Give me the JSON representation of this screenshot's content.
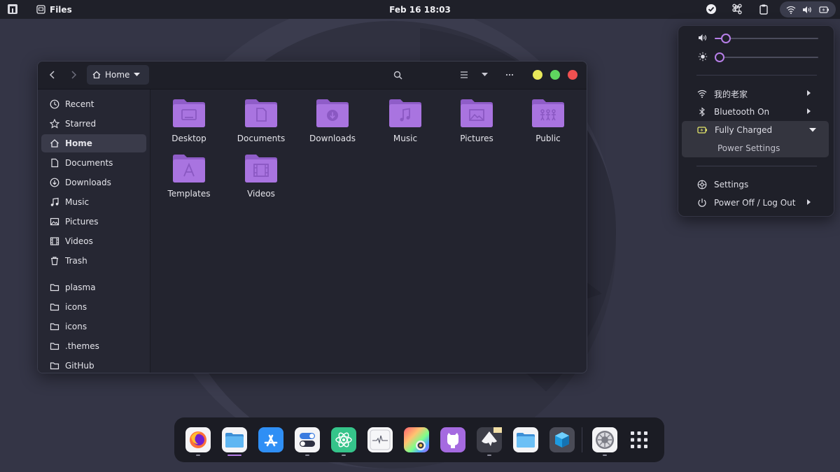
{
  "topbar": {
    "app_name": "Files",
    "clock": "Feb 16  18:03",
    "tray": [
      "checkmark-icon",
      "command-icon",
      "clipboard-icon"
    ],
    "status": [
      "wifi-icon",
      "volume-icon",
      "battery-icon"
    ]
  },
  "window": {
    "path": "Home",
    "sidebar": [
      {
        "label": "Recent",
        "icon": "clock-icon"
      },
      {
        "label": "Starred",
        "icon": "star-icon"
      },
      {
        "label": "Home",
        "icon": "home-icon",
        "active": true
      },
      {
        "label": "Documents",
        "icon": "document-icon"
      },
      {
        "label": "Downloads",
        "icon": "download-icon"
      },
      {
        "label": "Music",
        "icon": "music-icon"
      },
      {
        "label": "Pictures",
        "icon": "picture-icon"
      },
      {
        "label": "Videos",
        "icon": "video-icon"
      },
      {
        "label": "Trash",
        "icon": "trash-icon"
      }
    ],
    "bookmarks": [
      {
        "label": "plasma"
      },
      {
        "label": "icons"
      },
      {
        "label": "icons"
      },
      {
        "label": ".themes"
      },
      {
        "label": "GitHub"
      }
    ],
    "folders": [
      {
        "label": "Desktop",
        "emblem": "desktop"
      },
      {
        "label": "Documents",
        "emblem": "document"
      },
      {
        "label": "Downloads",
        "emblem": "download"
      },
      {
        "label": "Music",
        "emblem": "music"
      },
      {
        "label": "Pictures",
        "emblem": "picture"
      },
      {
        "label": "Public",
        "emblem": "people"
      },
      {
        "label": "Templates",
        "emblem": "template"
      },
      {
        "label": "Videos",
        "emblem": "video"
      }
    ]
  },
  "quick_settings": {
    "volume_level": 0.1,
    "brightness_level": 0.04,
    "items": {
      "wifi": "我的老家",
      "bluetooth": "Bluetooth On",
      "battery": "Fully Charged",
      "power_settings": "Power Settings",
      "settings": "Settings",
      "power_off": "Power Off / Log Out"
    }
  },
  "dock": {
    "apps": [
      "firefox",
      "files",
      "app-store",
      "tweaks",
      "atom",
      "system-monitor",
      "color-picker",
      "github-desktop",
      "inkscape",
      "folder",
      "virtualbox"
    ],
    "pinned_extra": [
      "settings"
    ],
    "colors": {
      "accent": "#b77fe8",
      "folder": "#a974e0"
    }
  }
}
